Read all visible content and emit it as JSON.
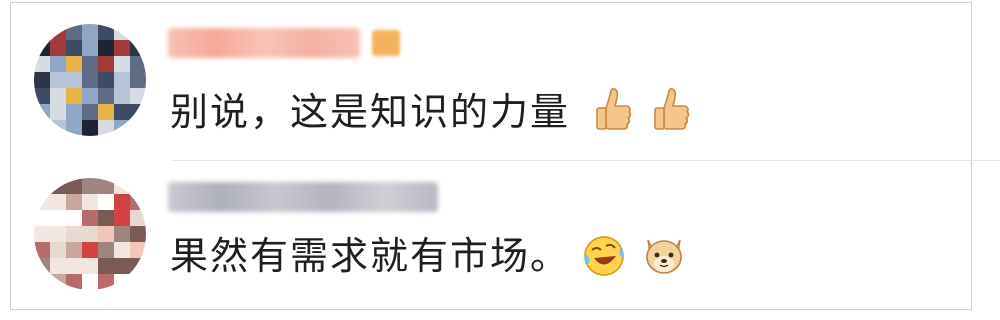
{
  "comments": [
    {
      "text": "别说，这是知识的力量",
      "emojis": [
        "thumbs-up-icon",
        "thumbs-up-icon"
      ],
      "colors": {
        "username": "#f7b5a6",
        "badge": "#f3b35e"
      }
    },
    {
      "text": "果然有需求就有市场。",
      "emojis": [
        "laughing-crying-icon",
        "doge-icon"
      ],
      "colors": {
        "username": "#b9b9c4"
      }
    }
  ]
}
